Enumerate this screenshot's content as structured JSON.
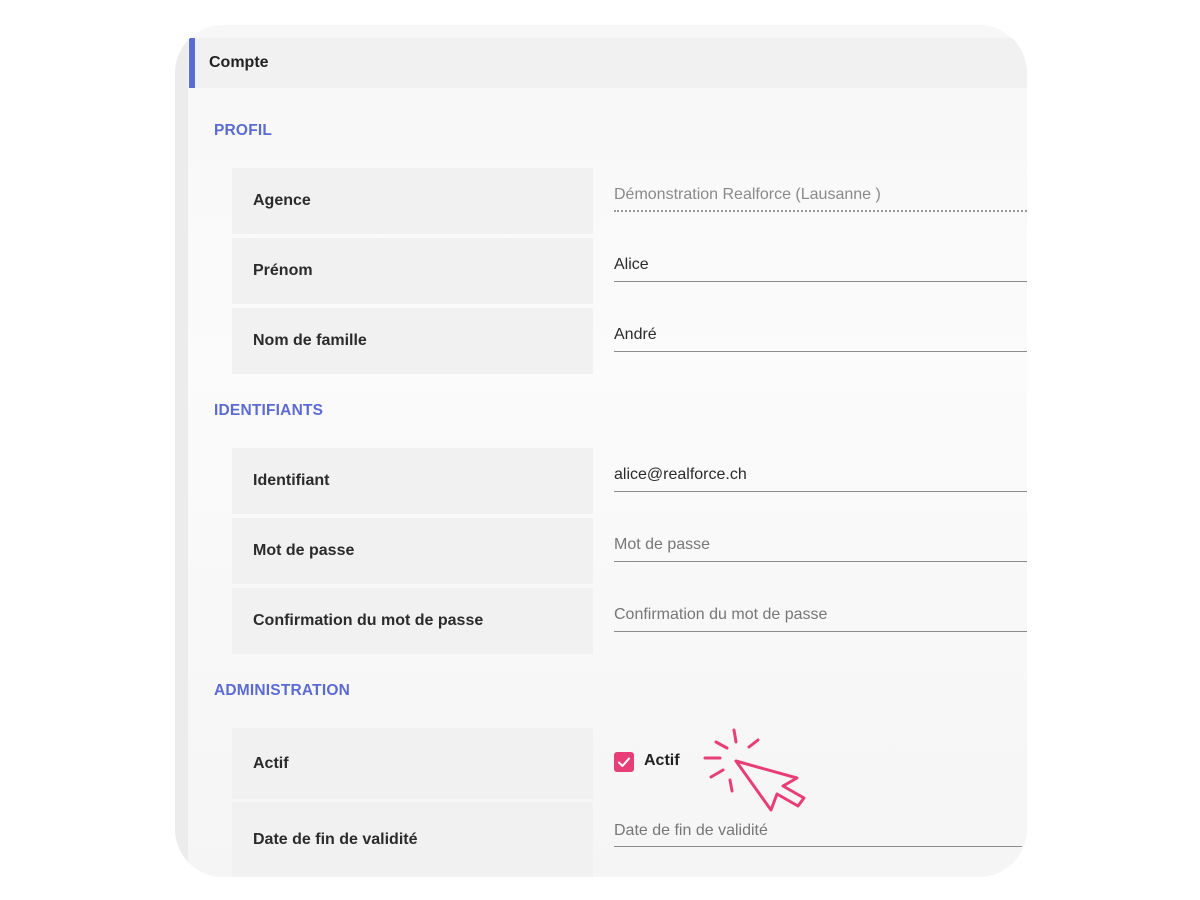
{
  "header": {
    "title": "Compte"
  },
  "sections": {
    "profil": "PROFIL",
    "identifiants": "IDENTIFIANTS",
    "administration": "ADMINISTRATION"
  },
  "profil": {
    "agence_label": "Agence",
    "agence_value": "Démonstration Realforce (Lausanne )",
    "prenom_label": "Prénom",
    "prenom_value": "Alice",
    "nom_label": "Nom de famille",
    "nom_value": "André"
  },
  "identifiants": {
    "identifiant_label": "Identifiant",
    "identifiant_value": "alice@realforce.ch",
    "password_label": "Mot de passe",
    "password_placeholder": "Mot de passe",
    "confirm_label": "Confirmation du mot de passe",
    "confirm_placeholder": "Confirmation du mot de passe"
  },
  "administration": {
    "actif_label": "Actif",
    "actif_checkbox_label": "Actif",
    "actif_checked": true,
    "date_label": "Date de fin de validité",
    "date_placeholder": "Date de fin de validité"
  },
  "colors": {
    "accent": "#5b6bd3",
    "checkbox": "#e83e78",
    "cursor": "#e83e78"
  },
  "icons": [
    "check-icon",
    "click-cursor-icon"
  ]
}
